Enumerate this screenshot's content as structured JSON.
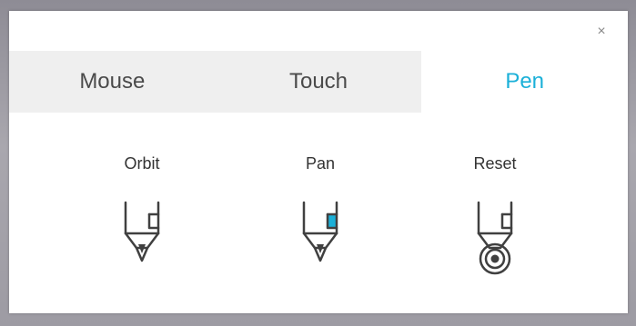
{
  "dialog": {
    "close_label": "×"
  },
  "tabs": [
    {
      "label": "Mouse",
      "active": false
    },
    {
      "label": "Touch",
      "active": false
    },
    {
      "label": "Pen",
      "active": true
    }
  ],
  "options": [
    {
      "label": "Orbit",
      "icon": "pen-tip-icon"
    },
    {
      "label": "Pan",
      "icon": "pen-barrel-button-icon"
    },
    {
      "label": "Reset",
      "icon": "pen-double-tap-icon"
    }
  ],
  "colors": {
    "accent": "#1bb0d8",
    "tab_bar": "#efefef",
    "text": "#333333",
    "icon_stroke": "#404040"
  }
}
